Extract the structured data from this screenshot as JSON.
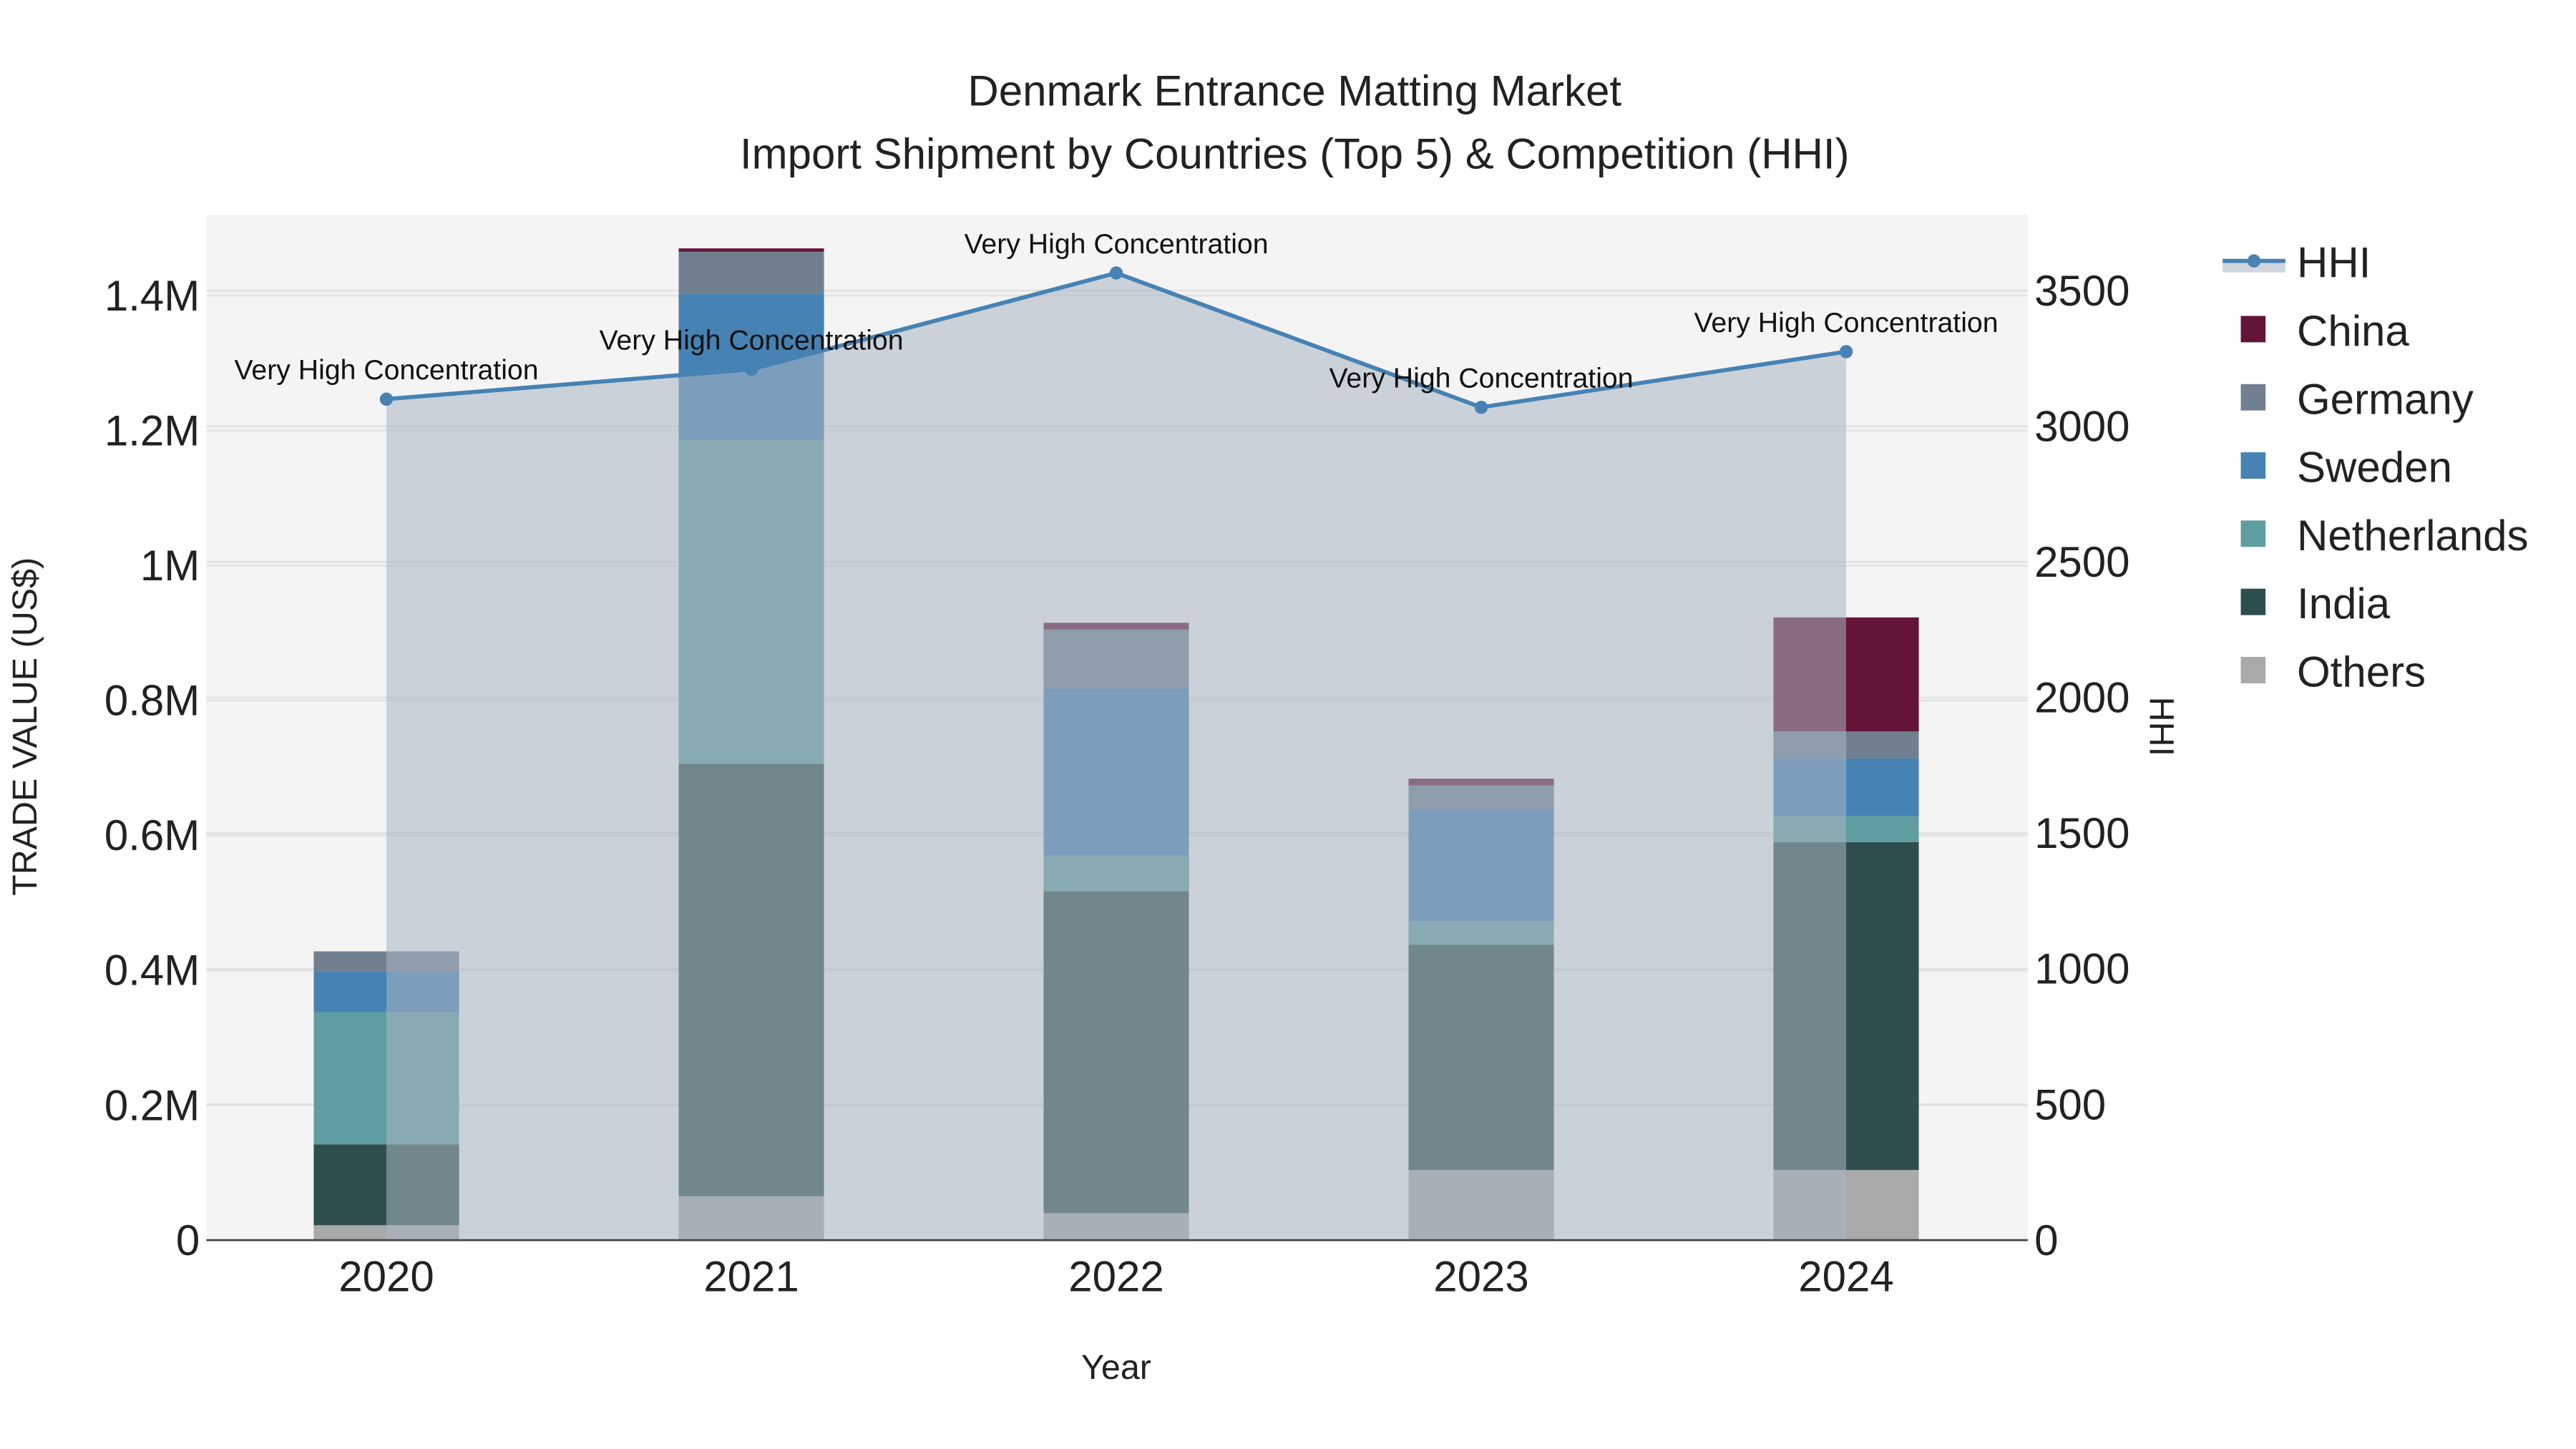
{
  "chart_data": {
    "type": "bar",
    "title": "Denmark Entrance Matting Market",
    "subtitle": "Import Shipment by Countries (Top 5) & Competition (HHI)",
    "xlabel": "Year",
    "ylabel": "TRADE VALUE (US$)",
    "y2label": "HHI",
    "categories": [
      "2020",
      "2021",
      "2022",
      "2023",
      "2024"
    ],
    "ylim": [
      0,
      1520000
    ],
    "y2lim": [
      0,
      3780
    ],
    "yticks": [
      0,
      200000,
      400000,
      600000,
      800000,
      1000000,
      1200000,
      1400000
    ],
    "ytick_labels": [
      "0",
      "0.2M",
      "0.4M",
      "0.6M",
      "0.8M",
      "1M",
      "1.2M",
      "1.4M"
    ],
    "y2ticks": [
      0,
      500,
      1000,
      1500,
      2000,
      2500,
      3000,
      3500
    ],
    "y2tick_labels": [
      "0",
      "500",
      "1000",
      "1500",
      "2000",
      "2500",
      "3000",
      "3500"
    ],
    "stacked": true,
    "series": [
      {
        "name": "Others",
        "color": "#a9a9a9",
        "values": [
          22000,
          65000,
          40000,
          104000,
          104000
        ]
      },
      {
        "name": "India",
        "color": "#2f4f4f",
        "values": [
          120000,
          641000,
          477000,
          334000,
          486000
        ]
      },
      {
        "name": "Netherlands",
        "color": "#5f9ea0",
        "values": [
          196000,
          480000,
          53000,
          35000,
          39000
        ]
      },
      {
        "name": "Sweden",
        "color": "#4682b4",
        "values": [
          60000,
          217000,
          248000,
          164000,
          85000
        ]
      },
      {
        "name": "Germany",
        "color": "#708090",
        "values": [
          30000,
          62000,
          87000,
          37000,
          40000
        ]
      },
      {
        "name": "China",
        "color": "#631437",
        "values": [
          0,
          5000,
          10000,
          10000,
          169000
        ]
      }
    ],
    "line": {
      "name": "HHI",
      "color": "#4682b4",
      "values": [
        3100,
        3210,
        3565,
        3070,
        3275
      ],
      "annotations": [
        "Very High Concentration",
        "Very High Concentration",
        "Very High Concentration",
        "Very High Concentration",
        "Very High Concentration"
      ]
    },
    "legend": [
      "HHI",
      "China",
      "Germany",
      "Sweden",
      "Netherlands",
      "India",
      "Others"
    ],
    "legend_position": "right",
    "grid": true
  }
}
